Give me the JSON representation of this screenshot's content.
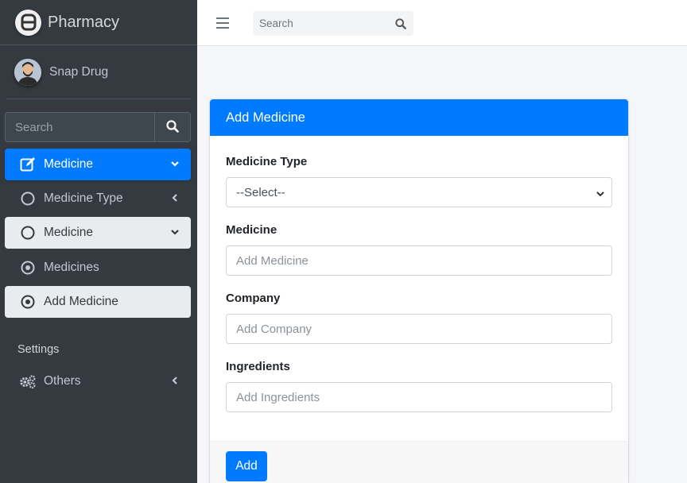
{
  "brand": {
    "name": "Pharmacy",
    "logo_icon": "pharmacy-logo-icon"
  },
  "user": {
    "name": "Snap Drug"
  },
  "sidebar": {
    "search_placeholder": "Search",
    "items": [
      {
        "label": "Medicine",
        "icon": "edit-icon",
        "state": "active",
        "arrow": "chevron-down-icon"
      },
      {
        "label": "Medicine Type",
        "icon": "circle-icon",
        "state": "normal",
        "arrow": "chevron-left-icon"
      },
      {
        "label": "Medicine",
        "icon": "circle-icon",
        "state": "open",
        "arrow": "chevron-down-icon"
      },
      {
        "label": "Medicines",
        "icon": "dot-circle-icon",
        "state": "normal"
      },
      {
        "label": "Add Medicine",
        "icon": "dot-circle-icon",
        "state": "selected"
      }
    ],
    "header": "Settings",
    "others": {
      "label": "Others",
      "icon": "gears-icon",
      "arrow": "chevron-left-icon"
    }
  },
  "topbar": {
    "search_placeholder": "Search"
  },
  "form": {
    "title": "Add Medicine",
    "medicine_type": {
      "label": "Medicine Type",
      "selected": "--Select--"
    },
    "medicine": {
      "label": "Medicine",
      "placeholder": "Add Medicine"
    },
    "company": {
      "label": "Company",
      "placeholder": "Add Company"
    },
    "ingredients": {
      "label": "Ingredients",
      "placeholder": "Add Ingredients"
    },
    "submit_label": "Add"
  },
  "colors": {
    "primary": "#007bff",
    "sidebar_bg": "#343a40",
    "content_bg": "#f4f6f9"
  }
}
